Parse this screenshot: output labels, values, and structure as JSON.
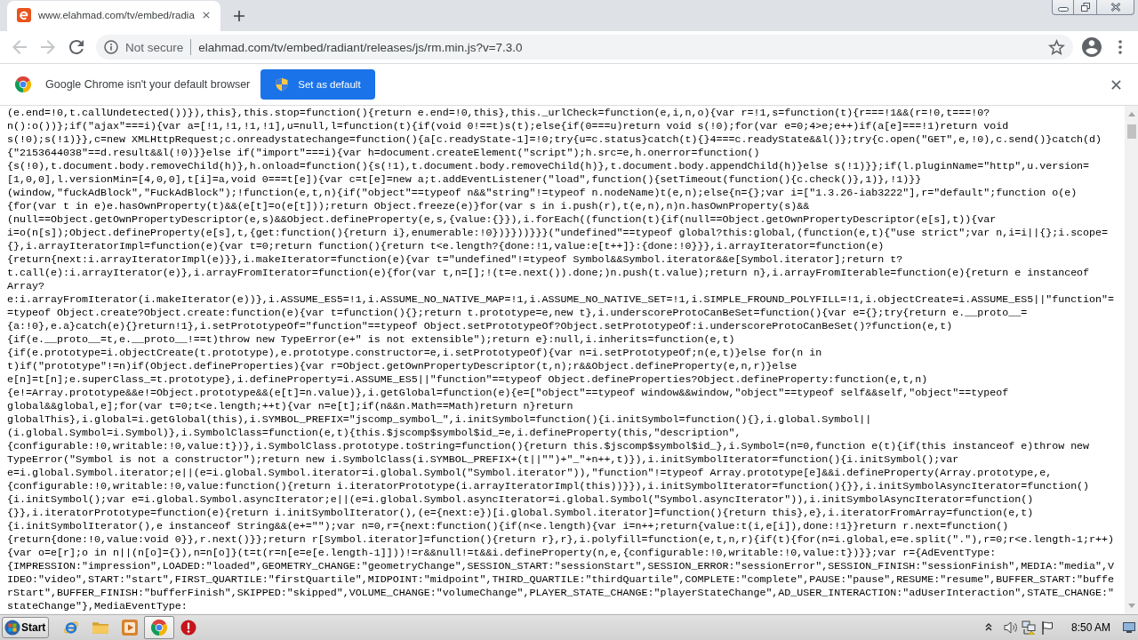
{
  "tabs": [
    {
      "title": "www.elahmad.com/tv/embed/radia",
      "selected": true
    }
  ],
  "nav_buttons": [
    {
      "kind": "back",
      "disabled": true
    },
    {
      "kind": "forward",
      "disabled": true
    },
    {
      "kind": "reload",
      "disabled": false
    }
  ],
  "address_bar": {
    "security_label": "Not secure",
    "url": "elahmad.com/tv/embed/radiant/releases/js/rm.min.js?v=7.3.0"
  },
  "infobar": {
    "message": "Google Chrome isn't your default browser",
    "button": "Set as default"
  },
  "source_lines": [
    "(e.end=!0,t.callUndetected())}),this},this.stop=function(){return e.end=!0,this},this._urlCheck=function(e,i,n,o){var r=!1,s=function(t){r===!1&&(r=!0,t===!0?",
    "n():o())};if(\"ajax\"===i){var a=[!1,!1,!1,!1],u=null,l=function(t){if(void 0!==t)s(t);else{if(0===u)return void s(!0);for(var e=0;4>e;e++)if(a[e]===!1)return void",
    "s(!0);s(!1)}},c=new XMLHttpRequest;c.onreadystatechange=function(){a[c.readyState-1]=!0;try{u=c.status}catch(t){}4===c.readyState&&l()};try{c.open(\"GET\",e,!0),c.send()}catch(d)",
    "{\"2153644038\"==d.result&&l(!0)}}else if(\"import\"===i){var h=document.createElement(\"script\");h.src=e,h.onerror=function()",
    "{s(!0),t.document.body.removeChild(h)},h.onload=function(){s(!1),t.document.body.removeChild(h)},t.document.body.appendChild(h)}else s(!1)}};if(l.pluginName=\"http\",u.version=",
    "[1,0,0],l.versionMin=[4,0,0],t[i]=a,void 0===t[e]){var c=t[e]=new a;t.addEventListener(\"load\",function(){setTimeout(function(){c.check()},1)},!1)}}",
    "(window,\"fuckAdBlock\",\"FuckAdBlock\");!function(e,t,n){if(\"object\"==typeof n&&\"string\"!=typeof n.nodeName)t(e,n);else{n={};var i=[\"1.3.26-iab3222\"],r=\"default\";function o(e)",
    "{for(var t in e)e.hasOwnProperty(t)&&(e[t]=o(e[t]));return Object.freeze(e)}for(var s in i.push(r),t(e,n),n)n.hasOwnProperty(s)&&",
    "(null==Object.getOwnPropertyDescriptor(e,s)&&Object.defineProperty(e,s,{value:{}}),i.forEach((function(t){if(null==Object.getOwnPropertyDescriptor(e[s],t)){var",
    "i=o(n[s]);Object.defineProperty(e[s],t,{get:function(){return i},enumerable:!0})}}))}}}(\"undefined\"==typeof global?this:global,(function(e,t){\"use strict\";var n,i=i||{};i.scope=",
    "{},i.arrayIteratorImpl=function(e){var t=0;return function(){return t<e.length?{done:!1,value:e[t++]}:{done:!0}}},i.arrayIterator=function(e)",
    "{return{next:i.arrayIteratorImpl(e)}},i.makeIterator=function(e){var t=\"undefined\"!=typeof Symbol&&Symbol.iterator&&e[Symbol.iterator];return t?",
    "t.call(e):i.arrayIterator(e)},i.arrayFromIterator=function(e){for(var t,n=[];!(t=e.next()).done;)n.push(t.value);return n},i.arrayFromIterable=function(e){return e instanceof",
    "Array?",
    "e:i.arrayFromIterator(i.makeIterator(e))},i.ASSUME_ES5=!1,i.ASSUME_NO_NATIVE_MAP=!1,i.ASSUME_NO_NATIVE_SET=!1,i.SIMPLE_FROUND_POLYFILL=!1,i.objectCreate=i.ASSUME_ES5||\"function\"=",
    "=typeof Object.create?Object.create:function(e){var t=function(){};return t.prototype=e,new t},i.underscoreProtoCanBeSet=function(){var e={};try{return e.__proto__=",
    "{a:!0},e.a}catch(e){}return!1},i.setPrototypeOf=\"function\"==typeof Object.setPrototypeOf?Object.setPrototypeOf:i.underscoreProtoCanBeSet()?function(e,t)",
    "{if(e.__proto__=t,e.__proto__!==t)throw new TypeError(e+\" is not extensible\");return e}:null,i.inherits=function(e,t)",
    "{if(e.prototype=i.objectCreate(t.prototype),e.prototype.constructor=e,i.setPrototypeOf){var n=i.setPrototypeOf;n(e,t)}else for(n in",
    "t)if(\"prototype\"!=n)if(Object.defineProperties){var r=Object.getOwnPropertyDescriptor(t,n);r&&Object.defineProperty(e,n,r)}else",
    "e[n]=t[n];e.superClass_=t.prototype},i.defineProperty=i.ASSUME_ES5||\"function\"==typeof Object.defineProperties?Object.defineProperty:function(e,t,n)",
    "{e!=Array.prototype&&e!=Object.prototype&&(e[t]=n.value)},i.getGlobal=function(e){e=[\"object\"==typeof window&&window,\"object\"==typeof self&&self,\"object\"==typeof",
    "global&&global,e];for(var t=0;t<e.length;++t){var n=e[t];if(n&&n.Math==Math)return n}return",
    "globalThis},i.global=i.getGlobal(this),i.SYMBOL_PREFIX=\"jscomp_symbol_\",i.initSymbol=function(){i.initSymbol=function(){},i.global.Symbol||",
    "(i.global.Symbol=i.Symbol)},i.SymbolClass=function(e,t){this.$jscomp$symbol$id_=e,i.defineProperty(this,\"description\",",
    "{configurable:!0,writable:!0,value:t})},i.SymbolClass.prototype.toString=function(){return this.$jscomp$symbol$id_},i.Symbol=(n=0,function e(t){if(this instanceof e)throw new",
    "TypeError(\"Symbol is not a constructor\");return new i.SymbolClass(i.SYMBOL_PREFIX+(t||\"\")+\"_\"+n++,t)}),i.initSymbolIterator=function(){i.initSymbol();var",
    "e=i.global.Symbol.iterator;e||(e=i.global.Symbol.iterator=i.global.Symbol(\"Symbol.iterator\")),\"function\"!=typeof Array.prototype[e]&&i.defineProperty(Array.prototype,e,",
    "{configurable:!0,writable:!0,value:function(){return i.iteratorPrototype(i.arrayIteratorImpl(this))}}),i.initSymbolIterator=function(){}},i.initSymbolAsyncIterator=function()",
    "{i.initSymbol();var e=i.global.Symbol.asyncIterator;e||(e=i.global.Symbol.asyncIterator=i.global.Symbol(\"Symbol.asyncIterator\")),i.initSymbolAsyncIterator=function()",
    "{}},i.iteratorPrototype=function(e){return i.initSymbolIterator(),(e={next:e})[i.global.Symbol.iterator]=function(){return this},e},i.iteratorFromArray=function(e,t)",
    "{i.initSymbolIterator(),e instanceof String&&(e+=\"\");var n=0,r={next:function(){if(n<e.length){var i=n++;return{value:t(i,e[i]),done:!1}}return r.next=function()",
    "{return{done:!0,value:void 0}},r.next()}};return r[Symbol.iterator]=function(){return r},r},i.polyfill=function(e,t,n,r){if(t){for(n=i.global,e=e.split(\".\"),r=0;r<e.length-1;r++)",
    "{var o=e[r];o in n||(n[o]={}),n=n[o]}(t=t(r=n[e=e[e.length-1]]))!=r&&null!=t&&i.defineProperty(n,e,{configurable:!0,writable:!0,value:t})}};var r={AdEventType:",
    "{IMPRESSION:\"impression\",LOADED:\"loaded\",GEOMETRY_CHANGE:\"geometryChange\",SESSION_START:\"sessionStart\",SESSION_ERROR:\"sessionError\",SESSION_FINISH:\"sessionFinish\",MEDIA:\"media\",V",
    "IDEO:\"video\",START:\"start\",FIRST_QUARTILE:\"firstQuartile\",MIDPOINT:\"midpoint\",THIRD_QUARTILE:\"thirdQuartile\",COMPLETE:\"complete\",PAUSE:\"pause\",RESUME:\"resume\",BUFFER_START:\"buffe",
    "rStart\",BUFFER_FINISH:\"bufferFinish\",SKIPPED:\"skipped\",VOLUME_CHANGE:\"volumeChange\",PLAYER_STATE_CHANGE:\"playerStateChange\",AD_USER_INTERACTION:\"adUserInteraction\",STATE_CHANGE:\"",
    "stateChange\"},MediaEventType:"
  ],
  "taskbar": {
    "start_label": "Start",
    "apps": [
      {
        "kind": "ie",
        "selected": false
      },
      {
        "kind": "folder",
        "selected": false
      },
      {
        "kind": "media",
        "selected": false
      },
      {
        "kind": "chrome",
        "selected": true
      },
      {
        "kind": "alert",
        "selected": false
      }
    ],
    "clock": "8:50 AM"
  }
}
